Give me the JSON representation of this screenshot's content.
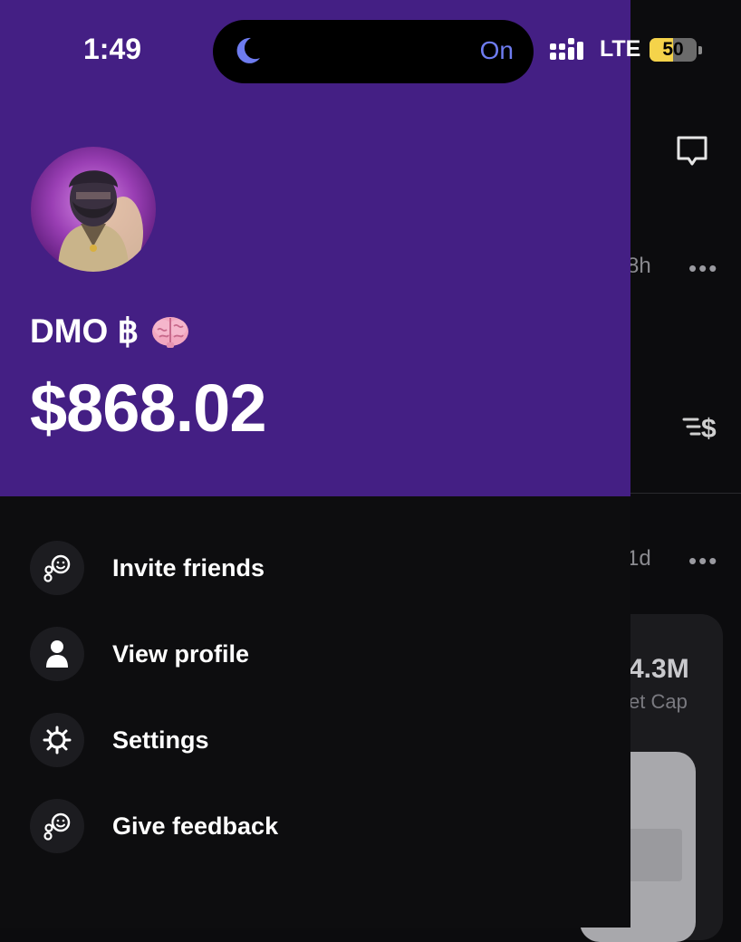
{
  "status_bar": {
    "time": "1:49",
    "focus_status": "On",
    "network": "LTE",
    "battery": "50",
    "battery_level": 0.5
  },
  "profile": {
    "username": "DMO ฿",
    "balance": "$868.02"
  },
  "menu": {
    "items": [
      {
        "label": "Invite friends",
        "icon": "invite-friends-icon"
      },
      {
        "label": "View profile",
        "icon": "person-icon"
      },
      {
        "label": "Settings",
        "icon": "gear-icon"
      },
      {
        "label": "Give feedback",
        "icon": "feedback-icon"
      }
    ]
  },
  "background": {
    "post1_time": "8h",
    "post2_time": "1d",
    "more_label": "•••",
    "market_cap_value": "4.3M",
    "market_cap_label": "et Cap"
  },
  "colors": {
    "header_purple": "#441f84",
    "drawer_bg": "#0d0d0f",
    "focus_accent": "#6e7cf0",
    "battery_yellow": "#f5d34a"
  }
}
